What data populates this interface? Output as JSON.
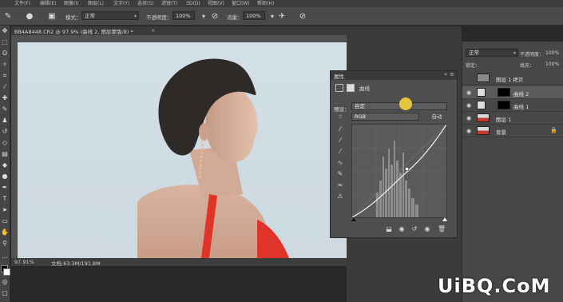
{
  "menu": {
    "items": [
      "文件(F)",
      "编辑(E)",
      "图像(I)",
      "图层(L)",
      "文字(Y)",
      "选择(S)",
      "滤镜(T)",
      "3D(D)",
      "视图(V)",
      "窗口(W)",
      "帮助(H)"
    ]
  },
  "options": {
    "mode_label": "模式：",
    "mode_value": "正常",
    "opacity_label": "不透明度：",
    "opacity_value": "100%",
    "flow_label": "流量：",
    "flow_value": "100%"
  },
  "document": {
    "tab_title": "BB4A8448.CR2 @ 97.9% (曲线 2, 图层蒙版/8) *",
    "close": "×",
    "zoom": "97.91%",
    "info": "文档:63.3M/191.8M"
  },
  "properties": {
    "panel_title": "属性",
    "adjustment_name": "曲线",
    "preset_label": "预设：",
    "preset_value": "自定",
    "channel_value": "RGB",
    "auto_button": "自动"
  },
  "layers_panel": {
    "blend_mode": "正常",
    "opacity_label": "不透明度：",
    "opacity_value": "100%",
    "lock_label": "锁定：",
    "fill_label": "填充：",
    "fill_value": "100%",
    "layers": [
      {
        "name": "图层 1 拷贝",
        "visible": false,
        "selected": false
      },
      {
        "name": "曲线 2",
        "visible": true,
        "selected": true
      },
      {
        "name": "曲线 1",
        "visible": true,
        "selected": false
      },
      {
        "name": "图层 1",
        "visible": true,
        "selected": false
      },
      {
        "name": "背景",
        "visible": true,
        "selected": false
      }
    ]
  },
  "watermark": "UiBQ.CoM",
  "colors": {
    "accent_cursor": "#f5d23a",
    "dress_red": "#e0342a"
  }
}
